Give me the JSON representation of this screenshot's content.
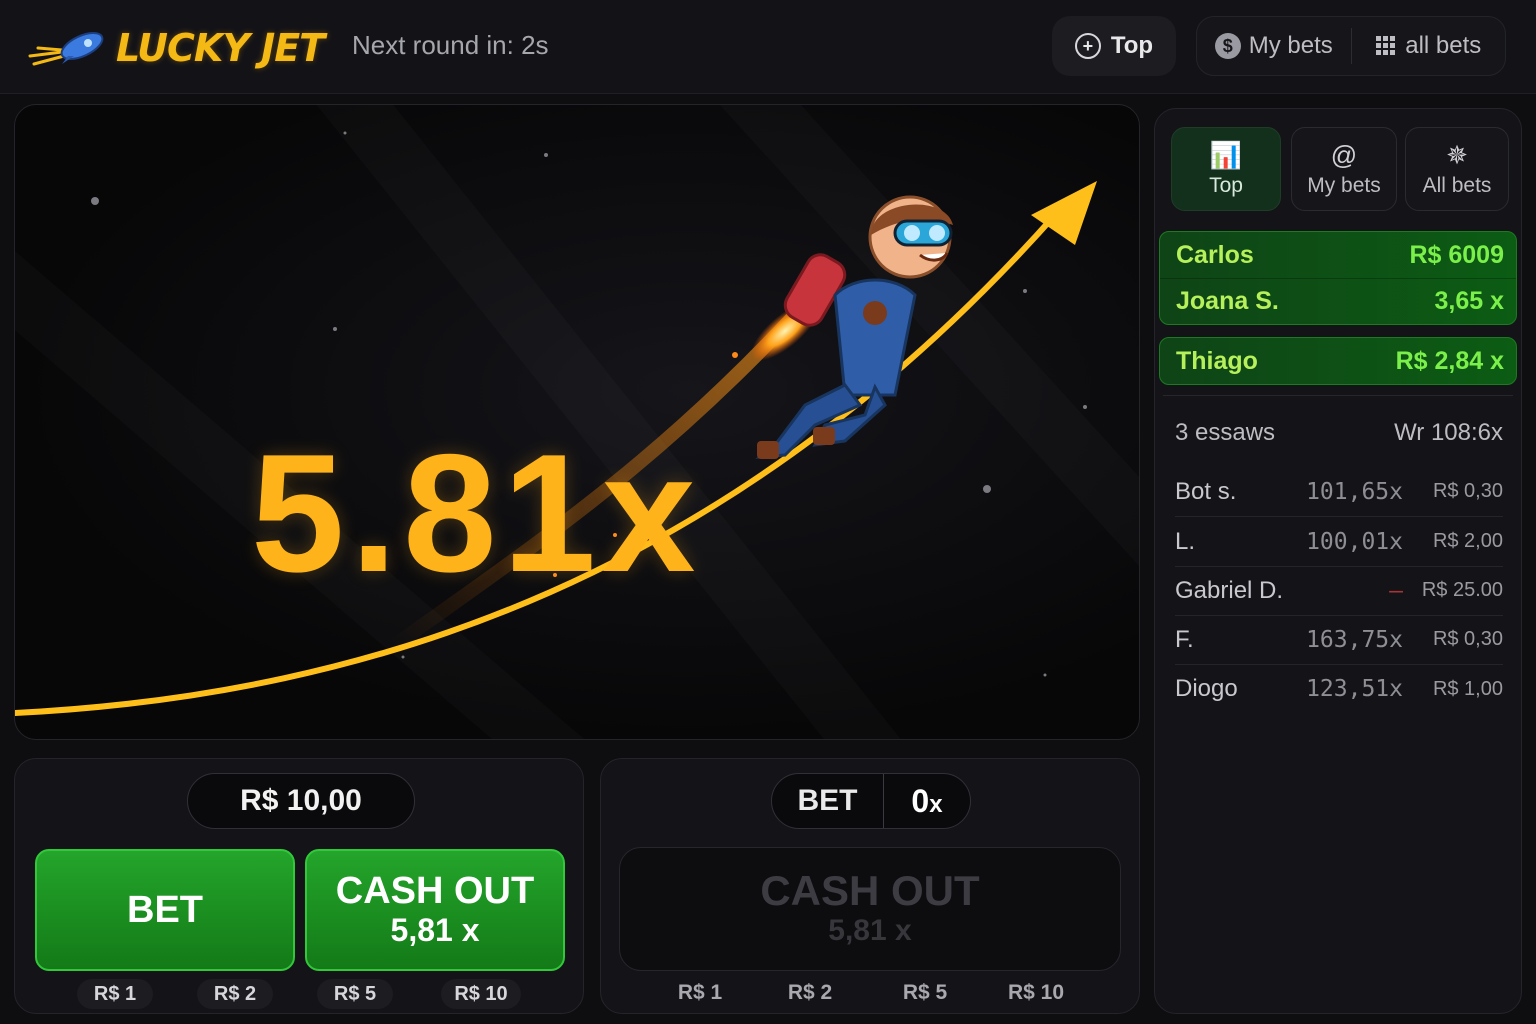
{
  "header": {
    "logo_text": "LUCKY JET",
    "next_round": "Next round in: 2s",
    "top_button": "Top",
    "my_bets": "My bets",
    "all_bets": "all bets"
  },
  "game": {
    "multiplier": "5.81x"
  },
  "bet_panel_1": {
    "amount": "R$ 10,00",
    "bet_label": "BET",
    "cashout_label": "CASH OUT",
    "cashout_value": "5,81 x",
    "quick_amounts": [
      "R$ 1",
      "R$ 2",
      "R$ 5",
      "R$ 10"
    ]
  },
  "bet_panel_2": {
    "toggle_label": "BET",
    "toggle_value": "0",
    "toggle_unit": "x",
    "cashout_label": "CASH OUT",
    "cashout_value": "5,81 x",
    "quick_amounts": [
      "R$ 1",
      "R$ 2",
      "R$ 5",
      "R$ 10"
    ]
  },
  "sidebar": {
    "tabs": [
      {
        "label": "Top",
        "icon": "chart-icon"
      },
      {
        "label": "My bets",
        "icon": "at-icon"
      },
      {
        "label": "All bets",
        "icon": "aperture-icon"
      }
    ],
    "highlights": [
      {
        "name": "Carlos",
        "value": "R$ 6009"
      },
      {
        "name": "Joana S.",
        "value": "3,65 x"
      },
      {
        "name": "Thiago",
        "value": "R$ 2,84 x"
      }
    ],
    "summary_left": "3 essaws",
    "summary_right": "Wr 108:6x",
    "rows": [
      {
        "name": "Bot s.",
        "mult": "101,65x",
        "amount": "R$ 0,30"
      },
      {
        "name": "L.",
        "mult": "100,01x",
        "amount": "R$ 2,00"
      },
      {
        "name": "Gabriel D.",
        "mult": "–",
        "amount": "R$ 25.00"
      },
      {
        "name": "F.",
        "mult": "163,75x",
        "amount": "R$ 0,30"
      },
      {
        "name": "Diogo",
        "mult": "123,51x",
        "amount": "R$ 1,00"
      }
    ]
  },
  "colors": {
    "accent": "#ffb31a",
    "green": "#1f9a26",
    "highlight_text": "#7cf04a"
  }
}
